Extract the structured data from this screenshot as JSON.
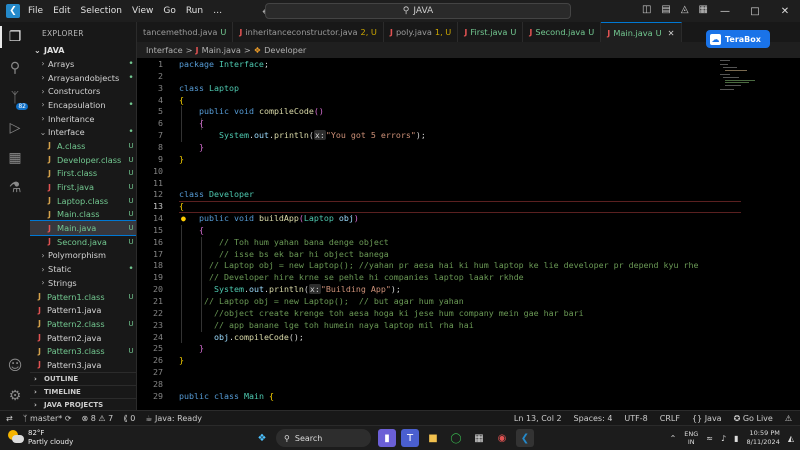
{
  "menu": [
    "File",
    "Edit",
    "Selection",
    "View",
    "Go",
    "Run"
  ],
  "menu_more": "…",
  "search": {
    "label": "JAVA"
  },
  "sidebar": {
    "header": "EXPLORER",
    "root": "JAVA",
    "items": [
      {
        "label": "Arrays",
        "kind": "folder",
        "open": false,
        "status": "dot"
      },
      {
        "label": "Arraysandobjects",
        "kind": "folder",
        "open": false,
        "status": "dot"
      },
      {
        "label": "Constructors",
        "kind": "folder",
        "open": false,
        "status": ""
      },
      {
        "label": "Encapsulation",
        "kind": "folder",
        "open": false,
        "status": "dot"
      },
      {
        "label": "Inheritance",
        "kind": "folder",
        "open": false,
        "status": ""
      },
      {
        "label": "Interface",
        "kind": "folder",
        "open": true,
        "status": "dot"
      },
      {
        "label": "A.class",
        "kind": "file",
        "status": "U"
      },
      {
        "label": "Developer.class",
        "kind": "file",
        "status": "U"
      },
      {
        "label": "First.class",
        "kind": "file",
        "status": "U"
      },
      {
        "label": "First.java",
        "kind": "java",
        "status": "U"
      },
      {
        "label": "Laptop.class",
        "kind": "file",
        "status": "U"
      },
      {
        "label": "Main.class",
        "kind": "file",
        "status": "U"
      },
      {
        "label": "Main.java",
        "kind": "java",
        "status": "U",
        "selected": true
      },
      {
        "label": "Second.java",
        "kind": "java",
        "status": "U"
      },
      {
        "label": "Polymorphism",
        "kind": "folder",
        "open": false,
        "status": ""
      },
      {
        "label": "Static",
        "kind": "folder",
        "open": false,
        "status": "dot"
      },
      {
        "label": "Strings",
        "kind": "folder",
        "open": false,
        "status": ""
      },
      {
        "label": "Pattern1.class",
        "kind": "file",
        "status": "U",
        "root": true
      },
      {
        "label": "Pattern1.java",
        "kind": "java",
        "status": "",
        "root": true
      },
      {
        "label": "Pattern2.class",
        "kind": "file",
        "status": "U",
        "root": true
      },
      {
        "label": "Pattern2.java",
        "kind": "java",
        "status": "",
        "root": true
      },
      {
        "label": "Pattern3.class",
        "kind": "file",
        "status": "U",
        "root": true
      },
      {
        "label": "Pattern3.java",
        "kind": "java",
        "status": "",
        "root": true
      }
    ],
    "sections": [
      "OUTLINE",
      "TIMELINE",
      "JAVA PROJECTS"
    ]
  },
  "tabs": [
    {
      "label": "tancemethod.java",
      "status": "U",
      "untracked": false,
      "active": false,
      "noicon": true
    },
    {
      "label": "inheritanceconstructor.java",
      "status": "2, U",
      "untracked": false,
      "active": false,
      "warn": true
    },
    {
      "label": "poly.java",
      "status": "1, U",
      "untracked": false,
      "active": false,
      "warn": true
    },
    {
      "label": "First.java",
      "status": "U",
      "untracked": true,
      "active": false
    },
    {
      "label": "Second.java",
      "status": "U",
      "untracked": true,
      "active": false
    },
    {
      "label": "Main.java",
      "status": "U",
      "untracked": true,
      "active": true
    }
  ],
  "breadcrumb": {
    "folder": "Interface",
    "file": "Main.java",
    "symbol": "Developer",
    "sep": ">"
  },
  "terabox": {
    "label": "TeraBox"
  },
  "code_lines": [
    {
      "n": "1",
      "html": "<span class='kw'>package</span> <span class='ty'>Interface</span><span class='pl'>;</span>"
    },
    {
      "n": "2",
      "html": ""
    },
    {
      "n": "3",
      "html": "<span class='kw'>class</span> <span class='ty'>Laptop</span>"
    },
    {
      "n": "4",
      "html": "<span class='br1'>{</span>"
    },
    {
      "n": "5",
      "html": "    <span class='kw'>public</span> <span class='kw'>void</span> <span class='fn'>compileCode</span><span class='br2'>()</span>"
    },
    {
      "n": "6",
      "html": "    <span class='br2'>{</span>"
    },
    {
      "n": "7",
      "html": "        <span class='ty'>System</span><span class='pl'>.</span><span class='var'>out</span><span class='pl'>.</span><span class='fn'>println</span><span class='pl'>(</span><span class='inlay'>x:</span><span class='str'>\"You got 5 errors\"</span><span class='pl'>);</span>"
    },
    {
      "n": "8",
      "html": "    <span class='br2'>}</span>"
    },
    {
      "n": "9",
      "html": "<span class='br1'>}</span>"
    },
    {
      "n": "10",
      "html": ""
    },
    {
      "n": "11",
      "html": ""
    },
    {
      "n": "12",
      "html": "<span class='kw'>class</span> <span class='ty'>Developer</span>"
    },
    {
      "n": "13",
      "html": "<span class='br1'>{</span>"
    },
    {
      "n": "14",
      "html": "    <span class='kw'>public</span> <span class='kw'>void</span> <span class='fn'>buildApp</span><span class='br2'>(</span><span class='ty'>Laptop</span> <span class='var'>obj</span><span class='br2'>)</span>"
    },
    {
      "n": "15",
      "html": "    <span class='br2'>{</span>"
    },
    {
      "n": "16",
      "html": "        <span class='cm'>// Toh hum yahan bana denge object</span>"
    },
    {
      "n": "17",
      "html": "        <span class='cm'>// isse bs ek bar hi object banega</span>"
    },
    {
      "n": "18",
      "html": "      <span class='cm'>// Laptop obj = new Laptop(); //yahan pr aesa hai ki hum laptop ke lie developer pr depend kyu rhe</span>"
    },
    {
      "n": "19",
      "html": "      <span class='cm'>// Developer hire krne se pehle hi companies laptop laakr rkhde</span>"
    },
    {
      "n": "20",
      "html": "       <span class='ty'>System</span><span class='pl'>.</span><span class='var'>out</span><span class='pl'>.</span><span class='fn'>println</span><span class='pl'>(</span><span class='inlay'>x:</span><span class='str'>\"Building App\"</span><span class='pl'>);</span>"
    },
    {
      "n": "21",
      "html": "     <span class='cm'>// Laptop obj = new Laptop();  // but agar hum yahan</span>"
    },
    {
      "n": "22",
      "html": "       <span class='cm'>//object create krenge toh aesa hoga ki jese hum company mein gae har bari</span>"
    },
    {
      "n": "23",
      "html": "       <span class='cm'>// app banane lge toh humein naya laptop mil rha hai</span>"
    },
    {
      "n": "24",
      "html": "       <span class='var'>obj</span><span class='pl'>.</span><span class='fn'>compileCode</span><span class='pl'>();</span>"
    },
    {
      "n": "25",
      "html": "    <span class='br2'>}</span>"
    },
    {
      "n": "26",
      "html": "<span class='br1'>}</span>"
    },
    {
      "n": "27",
      "html": ""
    },
    {
      "n": "28",
      "html": ""
    },
    {
      "n": "29",
      "html": "<span class='kw'>public</span> <span class='kw'>class</span> <span class='ty'>Main</span> <span class='br1'>{</span>"
    }
  ],
  "statusbar": {
    "branch": "master*",
    "sync": "⟳",
    "errors": "8",
    "warnings": "7",
    "ports": "0",
    "java": "Java: Ready",
    "position": "Ln 13, Col 2",
    "spaces": "Spaces: 4",
    "encoding": "UTF-8",
    "eol": "CRLF",
    "language": "Java",
    "golive": "Go Live"
  },
  "taskbar": {
    "temp": "82°F",
    "weather": "Partly cloudy",
    "search": "Search",
    "lang1": "ENG",
    "lang2": "IN",
    "time": "10:59 PM",
    "date": "8/11/2024"
  },
  "colors": {
    "accent": "#0078d4",
    "untracked": "#73c991",
    "java_icon": "#e05252",
    "terabox": "#1a73e8"
  }
}
